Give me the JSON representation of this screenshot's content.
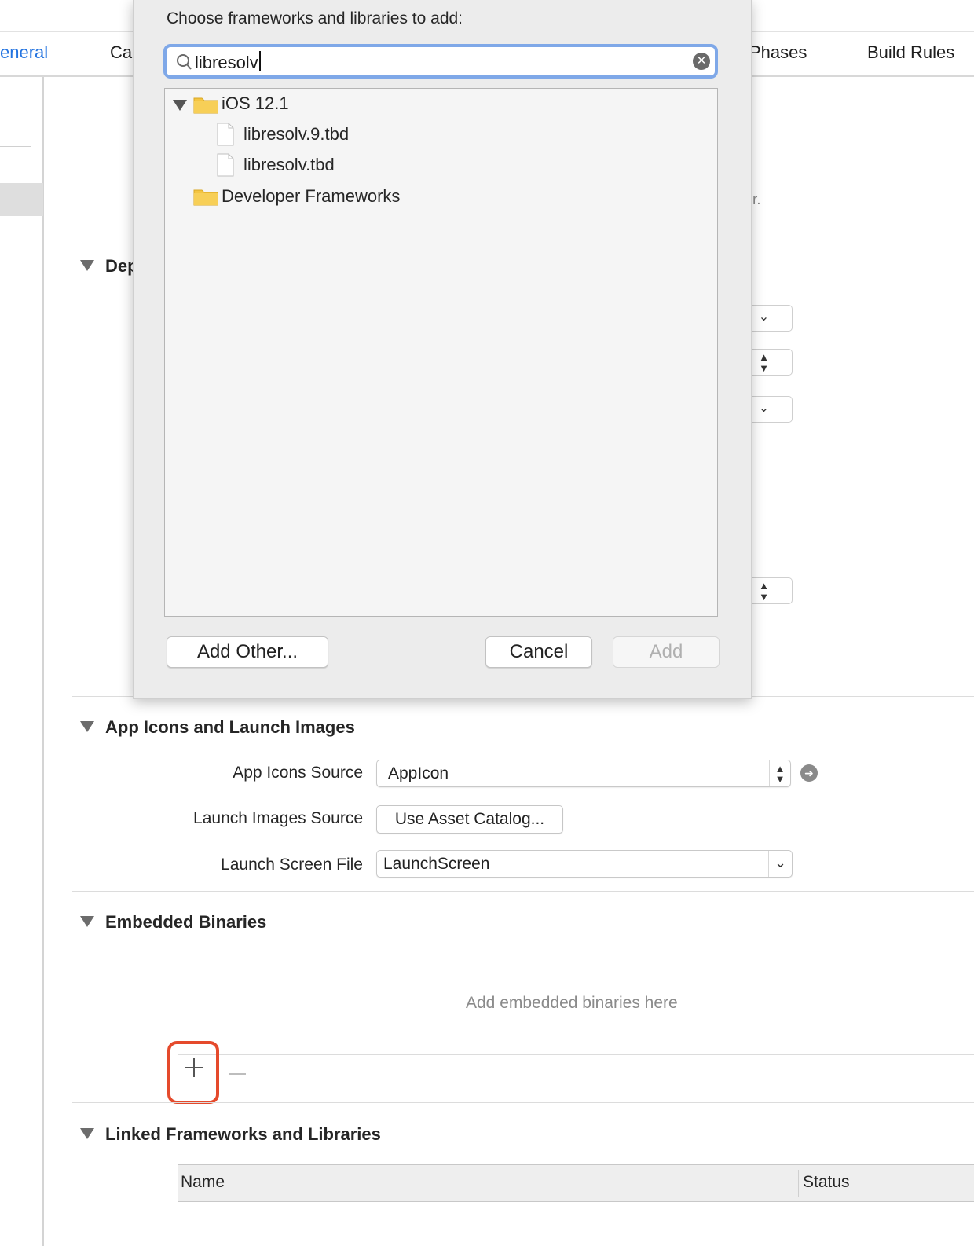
{
  "tabs": [
    {
      "label": "eneral",
      "active": true
    },
    {
      "label": "Ca"
    },
    {
      "label": "Phases"
    },
    {
      "label": "Build Rules"
    }
  ],
  "background_fragments": {
    "deployment_partial": "Dep",
    "hint_partial": "r."
  },
  "sections": {
    "app_icons": {
      "title": "App Icons and Launch Images",
      "app_icons_source_label": "App Icons Source",
      "app_icons_source_value": "AppIcon",
      "launch_images_source_label": "Launch Images Source",
      "launch_images_button": "Use Asset Catalog...",
      "launch_screen_label": "Launch Screen File",
      "launch_screen_value": "LaunchScreen"
    },
    "embedded_binaries": {
      "title": "Embedded Binaries",
      "placeholder": "Add embedded binaries here"
    },
    "linked_frameworks": {
      "title": "Linked Frameworks and Libraries",
      "columns": [
        "Name",
        "Status"
      ]
    }
  },
  "modal": {
    "title": "Choose frameworks and libraries to add:",
    "search_value": "libresolv",
    "tree": [
      {
        "label": "iOS 12.1",
        "type": "folder",
        "expanded": true
      },
      {
        "label": "libresolv.9.tbd",
        "type": "file"
      },
      {
        "label": "libresolv.tbd",
        "type": "file"
      },
      {
        "label": "Developer Frameworks",
        "type": "folder"
      }
    ],
    "buttons": {
      "add_other": "Add Other...",
      "cancel": "Cancel",
      "add": "Add"
    }
  },
  "colors": {
    "accent": "#2474e0",
    "highlight_border": "#e54a2c",
    "search_focus": "#7fa8e8",
    "folder": "#f4c542"
  },
  "icons": [
    "search-icon",
    "clear-search-icon",
    "folder-icon",
    "file-icon",
    "disclosure-triangle-icon",
    "arrow-right-circle-icon",
    "plus-icon",
    "minus-icon",
    "chevron-down-icon",
    "up-down-stepper-icon"
  ]
}
